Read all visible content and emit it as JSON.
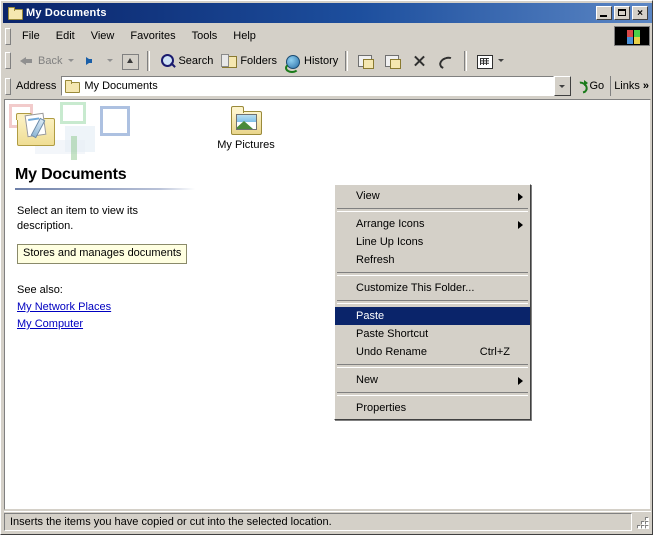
{
  "window": {
    "title": "My Documents",
    "icon": "folder-icon",
    "buttons": {
      "minimize": "minimize",
      "maximize": "maximize",
      "close": "×"
    }
  },
  "menubar": {
    "items": [
      {
        "label": "File",
        "name": "menu-file"
      },
      {
        "label": "Edit",
        "name": "menu-edit"
      },
      {
        "label": "View",
        "name": "menu-view"
      },
      {
        "label": "Favorites",
        "name": "menu-favorites"
      },
      {
        "label": "Tools",
        "name": "menu-tools"
      },
      {
        "label": "Help",
        "name": "menu-help"
      }
    ]
  },
  "toolbar": {
    "back_label": "Back",
    "forward_label": "",
    "up_label": "",
    "search_label": "Search",
    "folders_label": "Folders",
    "history_label": "History",
    "moveto_label": "",
    "copyto_label": "",
    "delete_label": "",
    "undo_label": "",
    "views_label": ""
  },
  "address": {
    "label": "Address",
    "value": "My Documents",
    "placeholder": "",
    "go_label": "Go",
    "links_label": "Links",
    "links_chevron": "»"
  },
  "infopanel": {
    "title": "My Documents",
    "description": "Select an item to view its description.",
    "tooltip": "Stores and manages documents",
    "seealso_label": "See also:",
    "links": [
      {
        "label": "My Network Places",
        "name": "link-my-network-places"
      },
      {
        "label": "My Computer",
        "name": "link-my-computer"
      }
    ]
  },
  "content": {
    "items": [
      {
        "label": "My Pictures",
        "name": "file-item-my-pictures",
        "icon": "pictures-folder-icon"
      }
    ]
  },
  "context_menu": {
    "items": [
      {
        "label": "View",
        "type": "submenu",
        "accel": "",
        "selected": false,
        "name": "ctx-view"
      },
      {
        "type": "separator"
      },
      {
        "label": "Arrange Icons",
        "type": "submenu",
        "accel": "",
        "selected": false,
        "name": "ctx-arrange-icons"
      },
      {
        "label": "Line Up Icons",
        "type": "item",
        "accel": "",
        "selected": false,
        "name": "ctx-line-up-icons"
      },
      {
        "label": "Refresh",
        "type": "item",
        "accel": "",
        "selected": false,
        "name": "ctx-refresh"
      },
      {
        "type": "separator"
      },
      {
        "label": "Customize This Folder...",
        "type": "item",
        "accel": "",
        "selected": false,
        "name": "ctx-customize-this-folder"
      },
      {
        "type": "separator"
      },
      {
        "label": "Paste",
        "type": "item",
        "accel": "",
        "selected": true,
        "name": "ctx-paste"
      },
      {
        "label": "Paste Shortcut",
        "type": "item",
        "accel": "",
        "selected": false,
        "name": "ctx-paste-shortcut"
      },
      {
        "label": "Undo Rename",
        "type": "item",
        "accel": "Ctrl+Z",
        "selected": false,
        "name": "ctx-undo-rename"
      },
      {
        "type": "separator"
      },
      {
        "label": "New",
        "type": "submenu",
        "accel": "",
        "selected": false,
        "name": "ctx-new"
      },
      {
        "type": "separator"
      },
      {
        "label": "Properties",
        "type": "item",
        "accel": "",
        "selected": false,
        "name": "ctx-properties"
      }
    ]
  },
  "statusbar": {
    "text": "Inserts the items you have copied or cut into the selected location."
  },
  "colors": {
    "titlebar_start": "#0a246a",
    "titlebar_end": "#5b86c4",
    "face": "#d4d0c8",
    "selection": "#0a246a",
    "link": "#0000c0",
    "tooltip_bg": "#ffffe1"
  }
}
